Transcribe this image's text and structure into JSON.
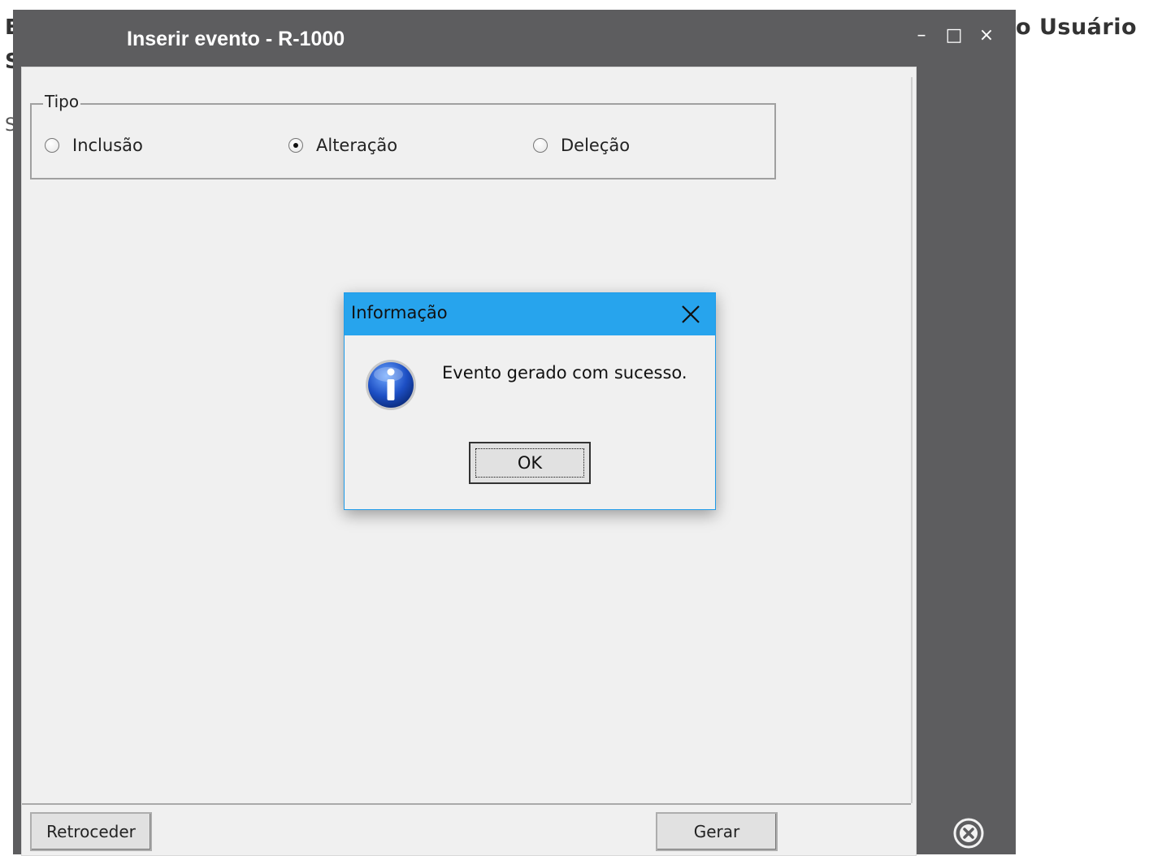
{
  "background": {
    "left_title_line1": "E",
    "left_title_line2": "S",
    "left_small": "S",
    "right_title": "o Usuário"
  },
  "modal": {
    "title": "Inserir evento - R-1000",
    "controls": {
      "minimize": "–",
      "maximize": "□",
      "close": "×"
    }
  },
  "group": {
    "legend": "Tipo",
    "options": [
      {
        "label": "Inclusão",
        "checked": false
      },
      {
        "label": "Alteração",
        "checked": true
      },
      {
        "label": "Deleção",
        "checked": false
      }
    ]
  },
  "buttons": {
    "back": "Retroceder",
    "generate": "Gerar"
  },
  "messagebox": {
    "title": "Informação",
    "message": "Evento gerado com sucesso.",
    "ok": "OK",
    "title_color": "#27a4ed"
  },
  "icons": [
    "minimize-icon",
    "maximize-icon",
    "close-icon",
    "close-circle-icon",
    "info-icon"
  ]
}
